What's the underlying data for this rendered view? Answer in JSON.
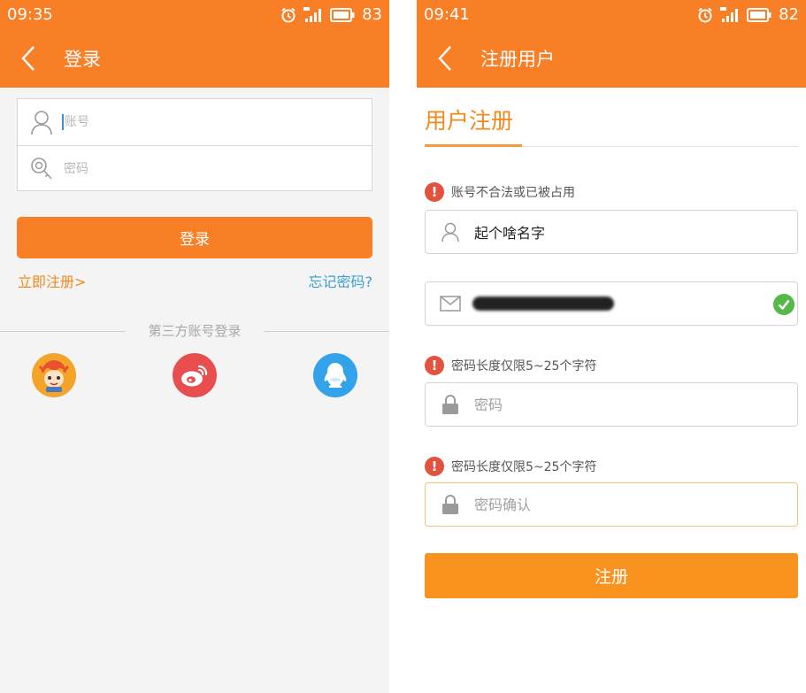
{
  "colors": {
    "brand": "#f97f27",
    "link_orange": "#f0891c",
    "link_blue": "#3b9fd3",
    "error": "#e2523e",
    "success": "#57b84a"
  },
  "left": {
    "status": {
      "time": "09:35",
      "battery": "83"
    },
    "title": "登录",
    "account_placeholder": "账号",
    "password_placeholder": "密码",
    "login_button": "登录",
    "register_link": "立即注册>",
    "forgot_link": "忘记密码?",
    "third_party_label": "第三方账号登录",
    "social": [
      "mascot-login-icon",
      "weibo-icon",
      "qq-icon"
    ]
  },
  "right": {
    "status": {
      "time": "09:41",
      "battery": "82"
    },
    "title": "注册用户",
    "heading": "用户注册",
    "username_error": "账号不合法或已被占用",
    "username_value": "起个啥名字",
    "password_error": "密码长度仅限5~25个字符",
    "password_placeholder": "密码",
    "confirm_error": "密码长度仅限5~25个字符",
    "confirm_placeholder": "密码确认",
    "register_button": "注册"
  }
}
